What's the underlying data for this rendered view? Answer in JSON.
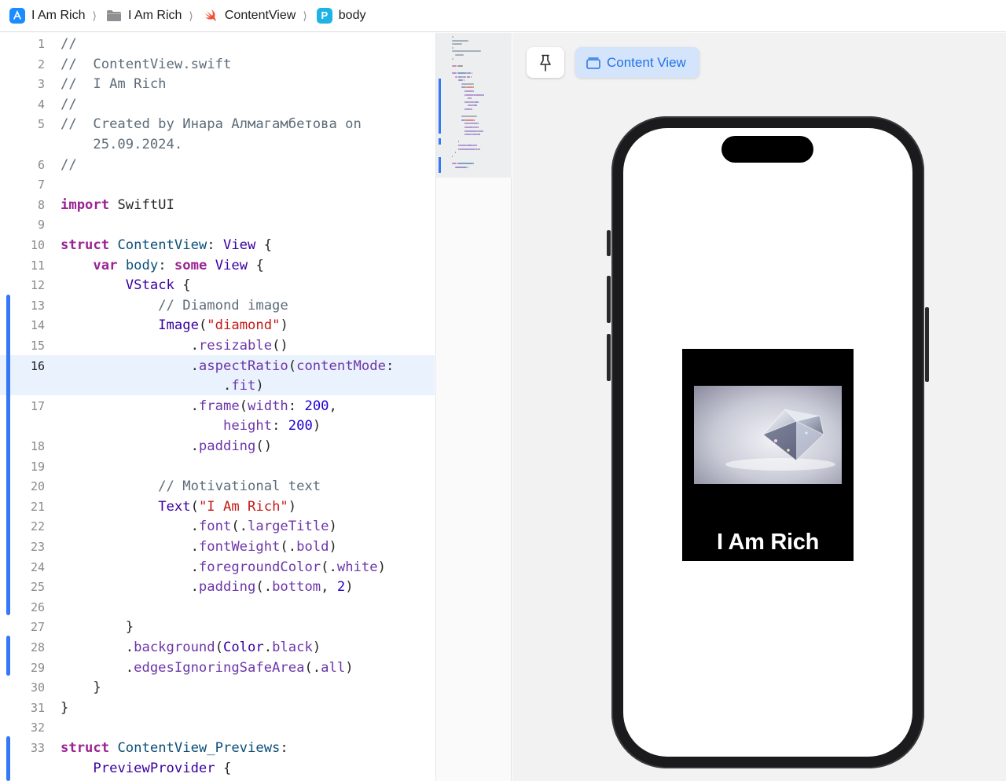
{
  "breadcrumb": {
    "items": [
      {
        "label": "I Am Rich",
        "icon": "app-icon"
      },
      {
        "label": "I Am Rich",
        "icon": "folder-icon"
      },
      {
        "label": "ContentView",
        "icon": "swift-file-icon"
      },
      {
        "label": "body",
        "icon": "property-icon",
        "badge": "P"
      }
    ],
    "separator": "⟩"
  },
  "editor": {
    "current_line": 16,
    "lines": [
      {
        "num": "1",
        "tokens": [
          {
            "t": "//",
            "c": "com"
          }
        ]
      },
      {
        "num": "2",
        "tokens": [
          {
            "t": "//  ContentView.swift",
            "c": "com"
          }
        ]
      },
      {
        "num": "3",
        "tokens": [
          {
            "t": "//  I Am Rich",
            "c": "com"
          }
        ]
      },
      {
        "num": "4",
        "tokens": [
          {
            "t": "//",
            "c": "com"
          }
        ]
      },
      {
        "num": "5",
        "tokens": [
          {
            "t": "//  Created by Инара Алмагамбетова on",
            "c": "com"
          }
        ]
      },
      {
        "num": "",
        "tokens": [
          {
            "t": "    25.09.2024.",
            "c": "com"
          }
        ]
      },
      {
        "num": "6",
        "tokens": [
          {
            "t": "//",
            "c": "com"
          }
        ]
      },
      {
        "num": "7",
        "tokens": []
      },
      {
        "num": "8",
        "tokens": [
          {
            "t": "import",
            "c": "kw"
          },
          {
            "t": " SwiftUI",
            "c": "plain"
          }
        ]
      },
      {
        "num": "9",
        "tokens": []
      },
      {
        "num": "10",
        "tokens": [
          {
            "t": "struct",
            "c": "kw"
          },
          {
            "t": " ",
            "c": "plain"
          },
          {
            "t": "ContentView",
            "c": "type"
          },
          {
            "t": ": ",
            "c": "plain"
          },
          {
            "t": "View",
            "c": "sys"
          },
          {
            "t": " {",
            "c": "plain"
          }
        ]
      },
      {
        "num": "11",
        "tokens": [
          {
            "t": "    ",
            "c": "plain"
          },
          {
            "t": "var",
            "c": "kw"
          },
          {
            "t": " ",
            "c": "plain"
          },
          {
            "t": "body",
            "c": "type"
          },
          {
            "t": ": ",
            "c": "plain"
          },
          {
            "t": "some",
            "c": "kw"
          },
          {
            "t": " ",
            "c": "plain"
          },
          {
            "t": "View",
            "c": "sys"
          },
          {
            "t": " {",
            "c": "plain"
          }
        ]
      },
      {
        "num": "12",
        "tokens": [
          {
            "t": "        ",
            "c": "plain"
          },
          {
            "t": "VStack",
            "c": "sys"
          },
          {
            "t": " {",
            "c": "plain"
          }
        ]
      },
      {
        "num": "13",
        "tokens": [
          {
            "t": "            // Diamond image",
            "c": "com"
          }
        ]
      },
      {
        "num": "14",
        "tokens": [
          {
            "t": "            ",
            "c": "plain"
          },
          {
            "t": "Image",
            "c": "sys"
          },
          {
            "t": "(",
            "c": "plain"
          },
          {
            "t": "\"diamond\"",
            "c": "str"
          },
          {
            "t": ")",
            "c": "plain"
          }
        ]
      },
      {
        "num": "15",
        "tokens": [
          {
            "t": "                .",
            "c": "plain"
          },
          {
            "t": "resizable",
            "c": "call"
          },
          {
            "t": "()",
            "c": "plain"
          }
        ]
      },
      {
        "num": "16",
        "tokens": [
          {
            "t": "                .",
            "c": "plain"
          },
          {
            "t": "aspectRatio",
            "c": "call"
          },
          {
            "t": "(",
            "c": "plain"
          },
          {
            "t": "contentMode",
            "c": "call"
          },
          {
            "t": ":",
            "c": "plain"
          }
        ]
      },
      {
        "num": "",
        "tokens": [
          {
            "t": "                    .",
            "c": "plain"
          },
          {
            "t": "fit",
            "c": "call"
          },
          {
            "t": ")",
            "c": "plain"
          }
        ]
      },
      {
        "num": "17",
        "tokens": [
          {
            "t": "                .",
            "c": "plain"
          },
          {
            "t": "frame",
            "c": "call"
          },
          {
            "t": "(",
            "c": "plain"
          },
          {
            "t": "width",
            "c": "call"
          },
          {
            "t": ": ",
            "c": "plain"
          },
          {
            "t": "200",
            "c": "num"
          },
          {
            "t": ",",
            "c": "plain"
          }
        ]
      },
      {
        "num": "",
        "tokens": [
          {
            "t": "                    ",
            "c": "plain"
          },
          {
            "t": "height",
            "c": "call"
          },
          {
            "t": ": ",
            "c": "plain"
          },
          {
            "t": "200",
            "c": "num"
          },
          {
            "t": ")",
            "c": "plain"
          }
        ]
      },
      {
        "num": "18",
        "tokens": [
          {
            "t": "                .",
            "c": "plain"
          },
          {
            "t": "padding",
            "c": "call"
          },
          {
            "t": "()",
            "c": "plain"
          }
        ]
      },
      {
        "num": "19",
        "tokens": []
      },
      {
        "num": "20",
        "tokens": [
          {
            "t": "            // Motivational text",
            "c": "com"
          }
        ]
      },
      {
        "num": "21",
        "tokens": [
          {
            "t": "            ",
            "c": "plain"
          },
          {
            "t": "Text",
            "c": "sys"
          },
          {
            "t": "(",
            "c": "plain"
          },
          {
            "t": "\"I Am Rich\"",
            "c": "str"
          },
          {
            "t": ")",
            "c": "plain"
          }
        ]
      },
      {
        "num": "22",
        "tokens": [
          {
            "t": "                .",
            "c": "plain"
          },
          {
            "t": "font",
            "c": "call"
          },
          {
            "t": "(.",
            "c": "plain"
          },
          {
            "t": "largeTitle",
            "c": "call"
          },
          {
            "t": ")",
            "c": "plain"
          }
        ]
      },
      {
        "num": "23",
        "tokens": [
          {
            "t": "                .",
            "c": "plain"
          },
          {
            "t": "fontWeight",
            "c": "call"
          },
          {
            "t": "(.",
            "c": "plain"
          },
          {
            "t": "bold",
            "c": "call"
          },
          {
            "t": ")",
            "c": "plain"
          }
        ]
      },
      {
        "num": "24",
        "tokens": [
          {
            "t": "                .",
            "c": "plain"
          },
          {
            "t": "foregroundColor",
            "c": "call"
          },
          {
            "t": "(.",
            "c": "plain"
          },
          {
            "t": "white",
            "c": "call"
          },
          {
            "t": ")",
            "c": "plain"
          }
        ]
      },
      {
        "num": "25",
        "tokens": [
          {
            "t": "                .",
            "c": "plain"
          },
          {
            "t": "padding",
            "c": "call"
          },
          {
            "t": "(.",
            "c": "plain"
          },
          {
            "t": "bottom",
            "c": "call"
          },
          {
            "t": ", ",
            "c": "plain"
          },
          {
            "t": "2",
            "c": "num"
          },
          {
            "t": ")",
            "c": "plain"
          }
        ]
      },
      {
        "num": "26",
        "tokens": []
      },
      {
        "num": "27",
        "tokens": [
          {
            "t": "        }",
            "c": "plain"
          }
        ]
      },
      {
        "num": "28",
        "tokens": [
          {
            "t": "        .",
            "c": "plain"
          },
          {
            "t": "background",
            "c": "call"
          },
          {
            "t": "(",
            "c": "plain"
          },
          {
            "t": "Color",
            "c": "sys"
          },
          {
            "t": ".",
            "c": "plain"
          },
          {
            "t": "black",
            "c": "call"
          },
          {
            "t": ")",
            "c": "plain"
          }
        ]
      },
      {
        "num": "29",
        "tokens": [
          {
            "t": "        .",
            "c": "plain"
          },
          {
            "t": "edgesIgnoringSafeArea",
            "c": "call"
          },
          {
            "t": "(.",
            "c": "plain"
          },
          {
            "t": "all",
            "c": "call"
          },
          {
            "t": ")",
            "c": "plain"
          }
        ]
      },
      {
        "num": "30",
        "tokens": [
          {
            "t": "    }",
            "c": "plain"
          }
        ]
      },
      {
        "num": "31",
        "tokens": [
          {
            "t": "}",
            "c": "plain"
          }
        ]
      },
      {
        "num": "32",
        "tokens": []
      },
      {
        "num": "33",
        "tokens": [
          {
            "t": "struct",
            "c": "kw"
          },
          {
            "t": " ",
            "c": "plain"
          },
          {
            "t": "ContentView_Previews",
            "c": "type"
          },
          {
            "t": ":",
            "c": "plain"
          }
        ]
      },
      {
        "num": "",
        "tokens": [
          {
            "t": "    ",
            "c": "plain"
          },
          {
            "t": "PreviewProvider",
            "c": "sys"
          },
          {
            "t": " {",
            "c": "plain"
          }
        ]
      }
    ]
  },
  "preview": {
    "pin_icon": "pin-icon",
    "variant_label": "Content View",
    "variant_icon": "preview-variant-icon",
    "app_text": "I Am Rich",
    "image_name": "diamond",
    "colors": {
      "background": "#000000",
      "text": "#ffffff",
      "accent": "#2173e8"
    }
  }
}
